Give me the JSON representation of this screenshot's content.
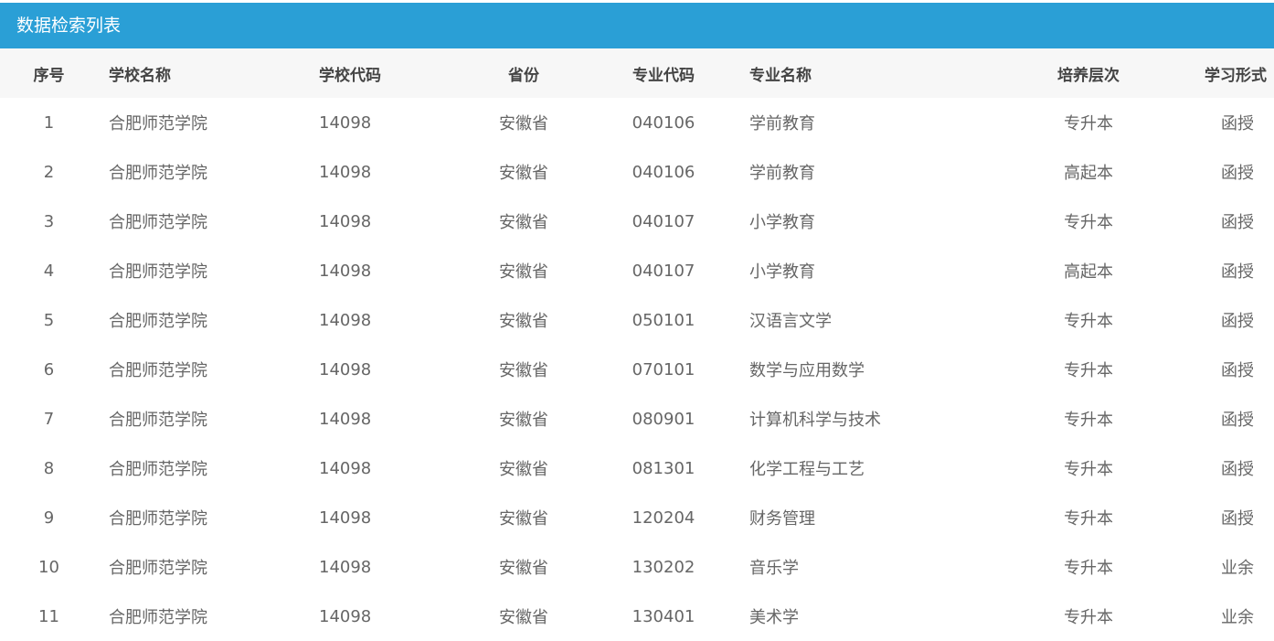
{
  "panel": {
    "title": "数据检索列表"
  },
  "table": {
    "headers": [
      "序号",
      "学校名称",
      "学校代码",
      "省份",
      "专业代码",
      "专业名称",
      "培养层次",
      "学习形式"
    ],
    "rows": [
      [
        "1",
        "合肥师范学院",
        "14098",
        "安徽省",
        "040106",
        "学前教育",
        "专升本",
        "函授"
      ],
      [
        "2",
        "合肥师范学院",
        "14098",
        "安徽省",
        "040106",
        "学前教育",
        "高起本",
        "函授"
      ],
      [
        "3",
        "合肥师范学院",
        "14098",
        "安徽省",
        "040107",
        "小学教育",
        "专升本",
        "函授"
      ],
      [
        "4",
        "合肥师范学院",
        "14098",
        "安徽省",
        "040107",
        "小学教育",
        "高起本",
        "函授"
      ],
      [
        "5",
        "合肥师范学院",
        "14098",
        "安徽省",
        "050101",
        "汉语言文学",
        "专升本",
        "函授"
      ],
      [
        "6",
        "合肥师范学院",
        "14098",
        "安徽省",
        "070101",
        "数学与应用数学",
        "专升本",
        "函授"
      ],
      [
        "7",
        "合肥师范学院",
        "14098",
        "安徽省",
        "080901",
        "计算机科学与技术",
        "专升本",
        "函授"
      ],
      [
        "8",
        "合肥师范学院",
        "14098",
        "安徽省",
        "081301",
        "化学工程与工艺",
        "专升本",
        "函授"
      ],
      [
        "9",
        "合肥师范学院",
        "14098",
        "安徽省",
        "120204",
        "财务管理",
        "专升本",
        "函授"
      ],
      [
        "10",
        "合肥师范学院",
        "14098",
        "安徽省",
        "130202",
        "音乐学",
        "专升本",
        "业余"
      ],
      [
        "11",
        "合肥师范学院",
        "14098",
        "安徽省",
        "130401",
        "美术学",
        "专升本",
        "业余"
      ]
    ]
  },
  "colors": {
    "header_bar": "#2a9fd6",
    "table_head_bg": "#f7f7f7",
    "body_text": "#666666"
  }
}
